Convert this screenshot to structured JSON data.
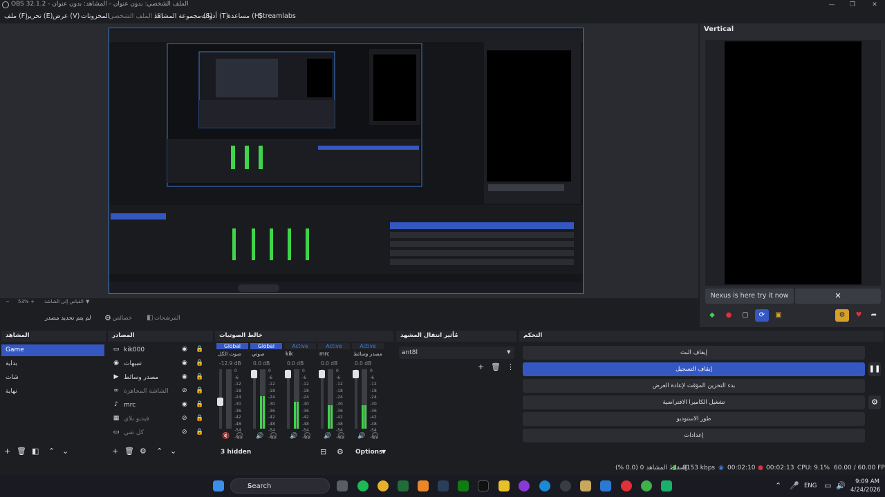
{
  "window": {
    "title": "OBS 32.1.2 - الملف الشخصي: بدون عنوان - المشاهد: بدون عنوان",
    "minimize": "—",
    "restore": "❐",
    "close": "✕"
  },
  "menu": [
    "ملف (F)",
    "تحرير (E)",
    "عرض (V)",
    "المخزونات",
    "الملف الشخصي (P)",
    "مجموعة المشاهد (S)",
    "أدوات (T)",
    "مساعدة (H)",
    "Streamlabs"
  ],
  "vertical": {
    "title": "Vertical",
    "notice": "Nexus is here try it now",
    "close": "✕"
  },
  "zoom": {
    "minus": "−",
    "value": "53%",
    "plus": "+",
    "mode": "القياس إلى الشاشة"
  },
  "toolbar": {
    "no_source": "لم يتم تحديد مصدر",
    "properties": "خصائص",
    "filters": "المرشحات"
  },
  "docks": {
    "scenes": "المشاهد",
    "sources": "المصادر",
    "mixer": "خالط الصوتيات",
    "transitions": "مُأثير انتقال المشهد",
    "controls": "التحكم"
  },
  "scenes": [
    "Game",
    "بداية",
    "شات",
    "نهاية"
  ],
  "sources": [
    {
      "icon": "▭",
      "name": "kik000",
      "hidden": false
    },
    {
      "icon": "◉",
      "name": "تنبيهات",
      "hidden": false
    },
    {
      "icon": "▶",
      "name": "مصدر وسائط",
      "hidden": false
    },
    {
      "icon": "∞",
      "name": "الشاشة المجاهزة",
      "hidden": true
    },
    {
      "icon": "🔊",
      "name": "mrc",
      "hidden": false
    },
    {
      "icon": "▦",
      "name": "فيديو بلاي",
      "hidden": true
    },
    {
      "icon": "▭",
      "name": "كل شي",
      "hidden": true
    }
  ],
  "mixer": [
    {
      "tab": "Global",
      "name": "صوت الكل",
      "db": "-12.9 dB",
      "scale": [
        "0",
        "-6",
        "-12",
        "-18",
        "-24",
        "-30",
        "-36",
        "-42",
        "-48",
        "-54",
        "-60"
      ],
      "muted": true
    },
    {
      "tab": "Global",
      "name": "صوتي",
      "db": "0.0 dB",
      "scale": [
        "0",
        "-6",
        "-12",
        "-18",
        "-24",
        "-30",
        "-36",
        "-42",
        "-48",
        "-54",
        "-60"
      ],
      "muted": false
    },
    {
      "tab": "Active",
      "name": "kik",
      "db": "0.0 dB",
      "scale": [
        "0",
        "-6",
        "-12",
        "-18",
        "-24",
        "-30",
        "-36",
        "-42",
        "-48",
        "-54",
        "-60"
      ],
      "muted": false
    },
    {
      "tab": "Active",
      "name": "mrc",
      "db": "0.0 dB",
      "scale": [
        "0",
        "-6",
        "-12",
        "-18",
        "-24",
        "-30",
        "-36",
        "-42",
        "-48",
        "-54",
        "-60"
      ],
      "muted": false
    },
    {
      "tab": "Active",
      "name": "مصدر وسائط",
      "db": "0.0 dB",
      "scale": [
        "0",
        "-6",
        "-12",
        "-18",
        "-24",
        "-30",
        "-36",
        "-42",
        "-48",
        "-54",
        "-60"
      ],
      "muted": false
    }
  ],
  "mixer_footer": {
    "hidden": "3 hidden",
    "options": "Options"
  },
  "transition": {
    "selected": "ant8l"
  },
  "controls": [
    {
      "label": "إيقاف البث",
      "on": false
    },
    {
      "label": "إيقاف التسجيل",
      "on": true
    },
    {
      "label": "بدء التخزين المؤقت لإعادة العرض",
      "on": false
    },
    {
      "label": "تشغيل الكاميرا الافتراضية",
      "on": false
    },
    {
      "label": "طور الاستوديو",
      "on": false
    },
    {
      "label": "إعدادات",
      "on": false
    }
  ],
  "status": {
    "dropped": "إسقاط المشاهد 0 (0.0 %)",
    "bitrate": "8153 kbps",
    "stream_time": "00:02:10",
    "rec_time": "00:02:13",
    "cpu": "CPU: 9.1%",
    "fps": "60.00 / 60.00 FPS"
  },
  "taskbar": {
    "search": "Search",
    "lang": "ENG",
    "time": "9:09 AM",
    "date": "4/24/2026"
  },
  "colors": {
    "accent": "#3457c2",
    "record": "#e0303a",
    "meter": "#3fd44a",
    "warn": "#d4a02a"
  }
}
